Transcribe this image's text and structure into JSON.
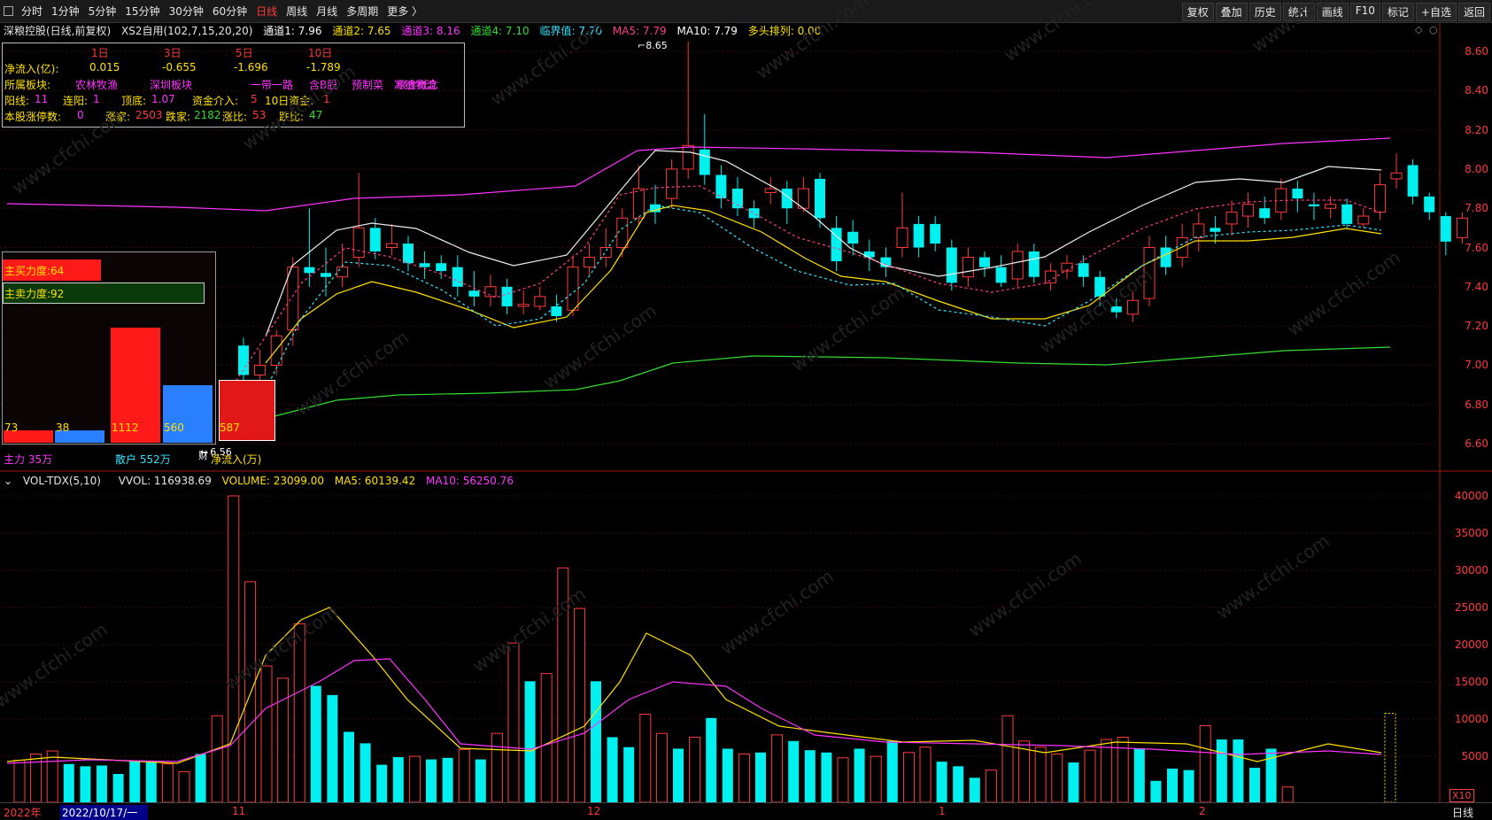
{
  "toolbar": {
    "periods": [
      "分时",
      "1分钟",
      "5分钟",
      "15分钟",
      "30分钟",
      "60分钟",
      "日线",
      "周线",
      "月线",
      "多周期",
      "更多 〉"
    ],
    "active_period": "日线",
    "right_buttons": [
      "复权",
      "叠加",
      "历史",
      "统计",
      "画线",
      "F10",
      "标记",
      "+自选",
      "返回"
    ]
  },
  "header": {
    "stock": "深粮控股(日线,前复权)",
    "indicator": "XS2自用(102,7,15,20,20)",
    "ch1": "通道1: 7.96",
    "ch2": "通道2: 7.65",
    "ch3": "通道3: 8.16",
    "ch4": "通道4: 7.10",
    "critical": "临界值: 7.70",
    "ma5": "MA5: 7.79",
    "ma10": "MA10: 7.79",
    "bull": "多头排列: 0.00"
  },
  "infobox": {
    "periods": [
      "1日",
      "3日",
      "5日",
      "10日"
    ],
    "netflow_label": "净流入(亿):",
    "netflow": [
      "0.015",
      "-0.655",
      "-1.696",
      "-1.789"
    ],
    "sector_label": "所属板块:",
    "sectors": [
      "农林牧渔",
      "深圳板块",
      "一带一路",
      "含B股",
      "预制菜",
      "冷链物流",
      "粮食概念"
    ],
    "yang_label": "阳线:",
    "yang": "11",
    "lianyang_label": "连阳:",
    "lianyang": "1",
    "top_label": "顶底:",
    "top": "1.07",
    "fund_label": "资金介入:",
    "fund": "5",
    "ten_label": "10日资金:",
    "ten": "1",
    "limit_label": "本股涨停数:",
    "limit": "0",
    "up_label": "涨家:",
    "up": "2503",
    "down_label": "跌家:",
    "down": "2182",
    "upratio_label": "涨比:",
    "upratio": "53",
    "downratio_label": "跌比:",
    "downratio": "47"
  },
  "sidebox": {
    "buy_label": "主买力度:64",
    "buy_value": 64,
    "sell_label": "主卖力度:92",
    "sell_value": 92,
    "bars": [
      {
        "label": "73",
        "value": 73,
        "color": "#ff1a1a"
      },
      {
        "label": "38",
        "value": 38,
        "color": "#2a7fff"
      },
      {
        "label": "1112",
        "value": 1112,
        "color": "#ff1a1a"
      },
      {
        "label": "560",
        "value": 560,
        "color": "#2a7fff"
      },
      {
        "label": "587",
        "value": 587,
        "color": "#e01818"
      }
    ],
    "main_force": "主力 35万",
    "retail": "散户 552万",
    "net_inflow": "净流入(万)",
    "low_mark": "6.56",
    "cai": "财"
  },
  "price_axis": [
    "8.60",
    "8.40",
    "8.20",
    "8.00",
    "7.80",
    "7.60",
    "7.40",
    "7.20",
    "7.00",
    "6.80",
    "6.60"
  ],
  "high_mark": "8.65",
  "volume_header": {
    "name": "VOL-TDX(5,10)",
    "vvol": "VVOL: 116938.69",
    "volume": "VOLUME: 23099.00",
    "ma5": "MA5: 60139.42",
    "ma10": "MA10: 56250.76"
  },
  "volume_axis": [
    "40000",
    "35000",
    "30000",
    "25000",
    "20000",
    "15000",
    "10000",
    "5000"
  ],
  "volume_unit": "X10",
  "date_bar": {
    "year": "2022年",
    "date": "2022/10/17/一",
    "m11": "11",
    "m12": "12",
    "m1": "1",
    "m2": "2"
  },
  "tab": "日线",
  "watermark": "www.cfchi.com"
}
